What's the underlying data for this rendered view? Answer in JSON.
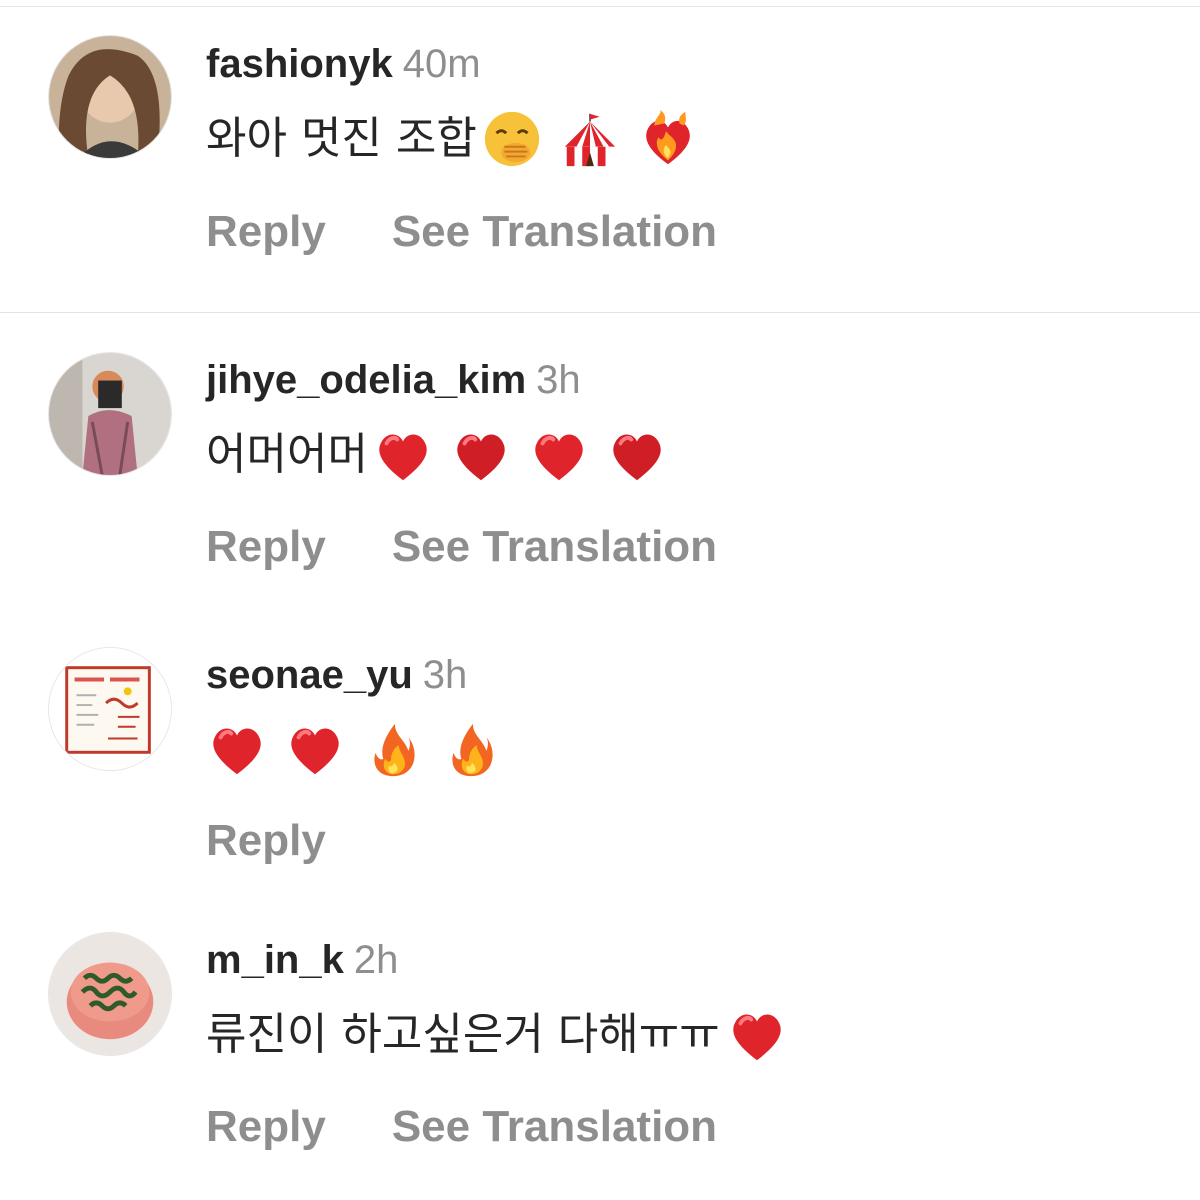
{
  "comments": [
    {
      "username": "fashionyk",
      "time": "40m",
      "text": "와아 멋진 조합",
      "emojis": [
        "face-with-hand-over-mouth-emoji",
        "circus-tent-emoji",
        "heart-on-fire-emoji"
      ],
      "actions": [
        "Reply",
        "See Translation"
      ]
    },
    {
      "username": "jihye_odelia_kim",
      "time": "3h",
      "text": "어머어머",
      "emojis": [
        "red-heart-emoji",
        "red-heart-emoji",
        "red-heart-emoji",
        "red-heart-emoji"
      ],
      "actions": [
        "Reply",
        "See Translation"
      ]
    },
    {
      "username": "seonae_yu",
      "time": "3h",
      "text": "",
      "emojis": [
        "red-heart-emoji",
        "red-heart-emoji",
        "fire-emoji",
        "fire-emoji"
      ],
      "actions": [
        "Reply"
      ]
    },
    {
      "username": "m_in_k",
      "time": "2h",
      "text": "류진이 하고싶은거 다해ㅠㅠ",
      "emojis": [
        "red-heart-emoji"
      ],
      "actions": [
        "Reply",
        "See Translation"
      ]
    }
  ],
  "colors": {
    "username": "#262626",
    "meta": "#8e8e8e",
    "heart": "#e0242c",
    "separator": "#e4e4e4"
  }
}
